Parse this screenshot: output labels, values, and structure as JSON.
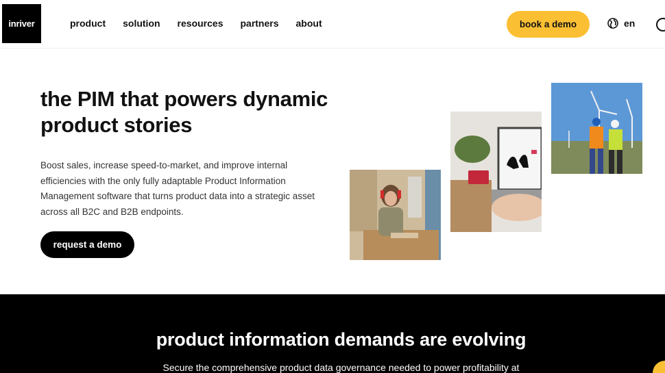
{
  "header": {
    "logo": "inriver",
    "nav": [
      "product",
      "solution",
      "resources",
      "partners",
      "about"
    ],
    "cta": "book a demo",
    "language": "en",
    "icons": {
      "globe": "globe-icon",
      "search": "search-icon"
    },
    "accent_color": "#fbbf33"
  },
  "hero": {
    "title": "the PIM that powers dynamic product stories",
    "body": "Boost sales, increase speed-to-market, and improve internal efficiencies with the only fully adaptable Product Information Management software that turns product data into a strategic asset across all B2C and B2B endpoints.",
    "cta": "request a demo"
  },
  "section2": {
    "title": "product information demands are evolving",
    "subtitle": "Secure the comprehensive product data governance needed to power profitability at"
  }
}
